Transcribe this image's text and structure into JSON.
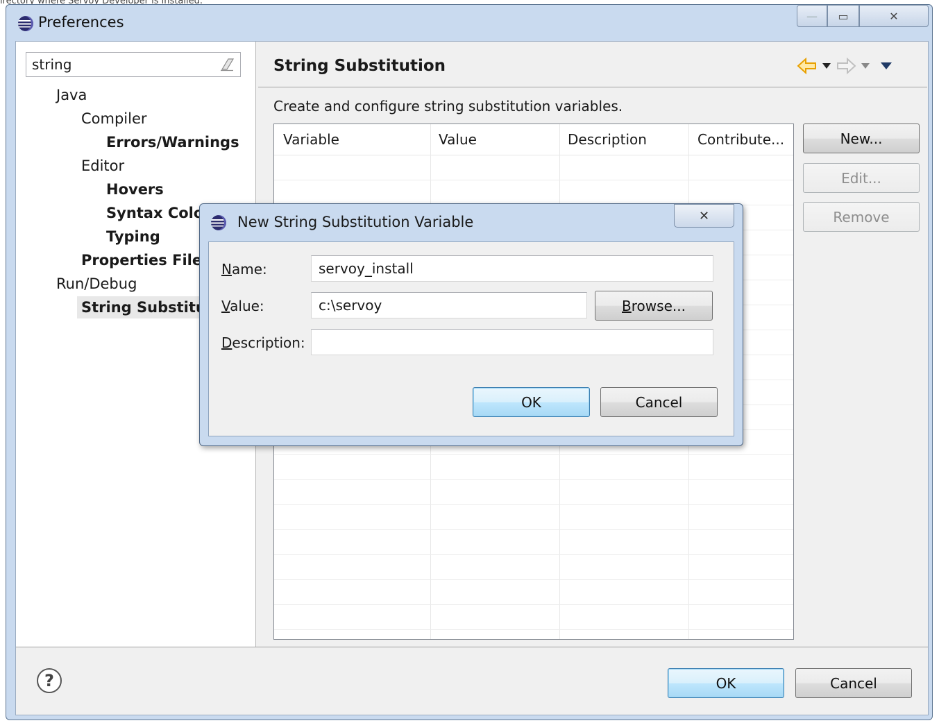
{
  "top_note": "irectory where Servoy Developer is installed.",
  "window": {
    "title": "Preferences",
    "controls": {
      "minimize": "—",
      "maximize": "▭",
      "close": "✕"
    }
  },
  "filter": {
    "value": "string"
  },
  "tree": [
    {
      "label": "Java",
      "bold": false
    },
    {
      "label": "Compiler",
      "bold": false
    },
    {
      "label": "Errors/Warnings",
      "bold": true
    },
    {
      "label": "Editor",
      "bold": false
    },
    {
      "label": "Hovers",
      "bold": true
    },
    {
      "label": "Syntax Colori",
      "bold": true
    },
    {
      "label": "Typing",
      "bold": true
    },
    {
      "label": "Properties Files I",
      "bold": true
    },
    {
      "label": "Run/Debug",
      "bold": false
    },
    {
      "label": "String Substituti",
      "bold": true
    }
  ],
  "page": {
    "title": "String Substitution",
    "description": "Create and configure string substitution variables.",
    "table": {
      "columns": [
        "Variable",
        "Value",
        "Description",
        "Contribute..."
      ],
      "rows": []
    },
    "buttons": {
      "new": "New...",
      "edit": "Edit...",
      "remove": "Remove"
    }
  },
  "footer": {
    "ok": "OK",
    "cancel": "Cancel"
  },
  "dialog": {
    "title": "New String Substitution Variable",
    "close": "✕",
    "name_label": {
      "u": "N",
      "rest": "ame:"
    },
    "value_label": {
      "u": "V",
      "rest": "alue:"
    },
    "description_label": {
      "u": "D",
      "rest": "escription:"
    },
    "name_value": "servoy_install",
    "value_value": "c:\\servoy",
    "description_value": "",
    "browse": {
      "u": "B",
      "rest": "rowse..."
    },
    "ok": "OK",
    "cancel": "Cancel"
  },
  "colors": {
    "accent": "#3c7fb1",
    "frame": "#c9daef",
    "nav_arrow": "#e8a000"
  }
}
